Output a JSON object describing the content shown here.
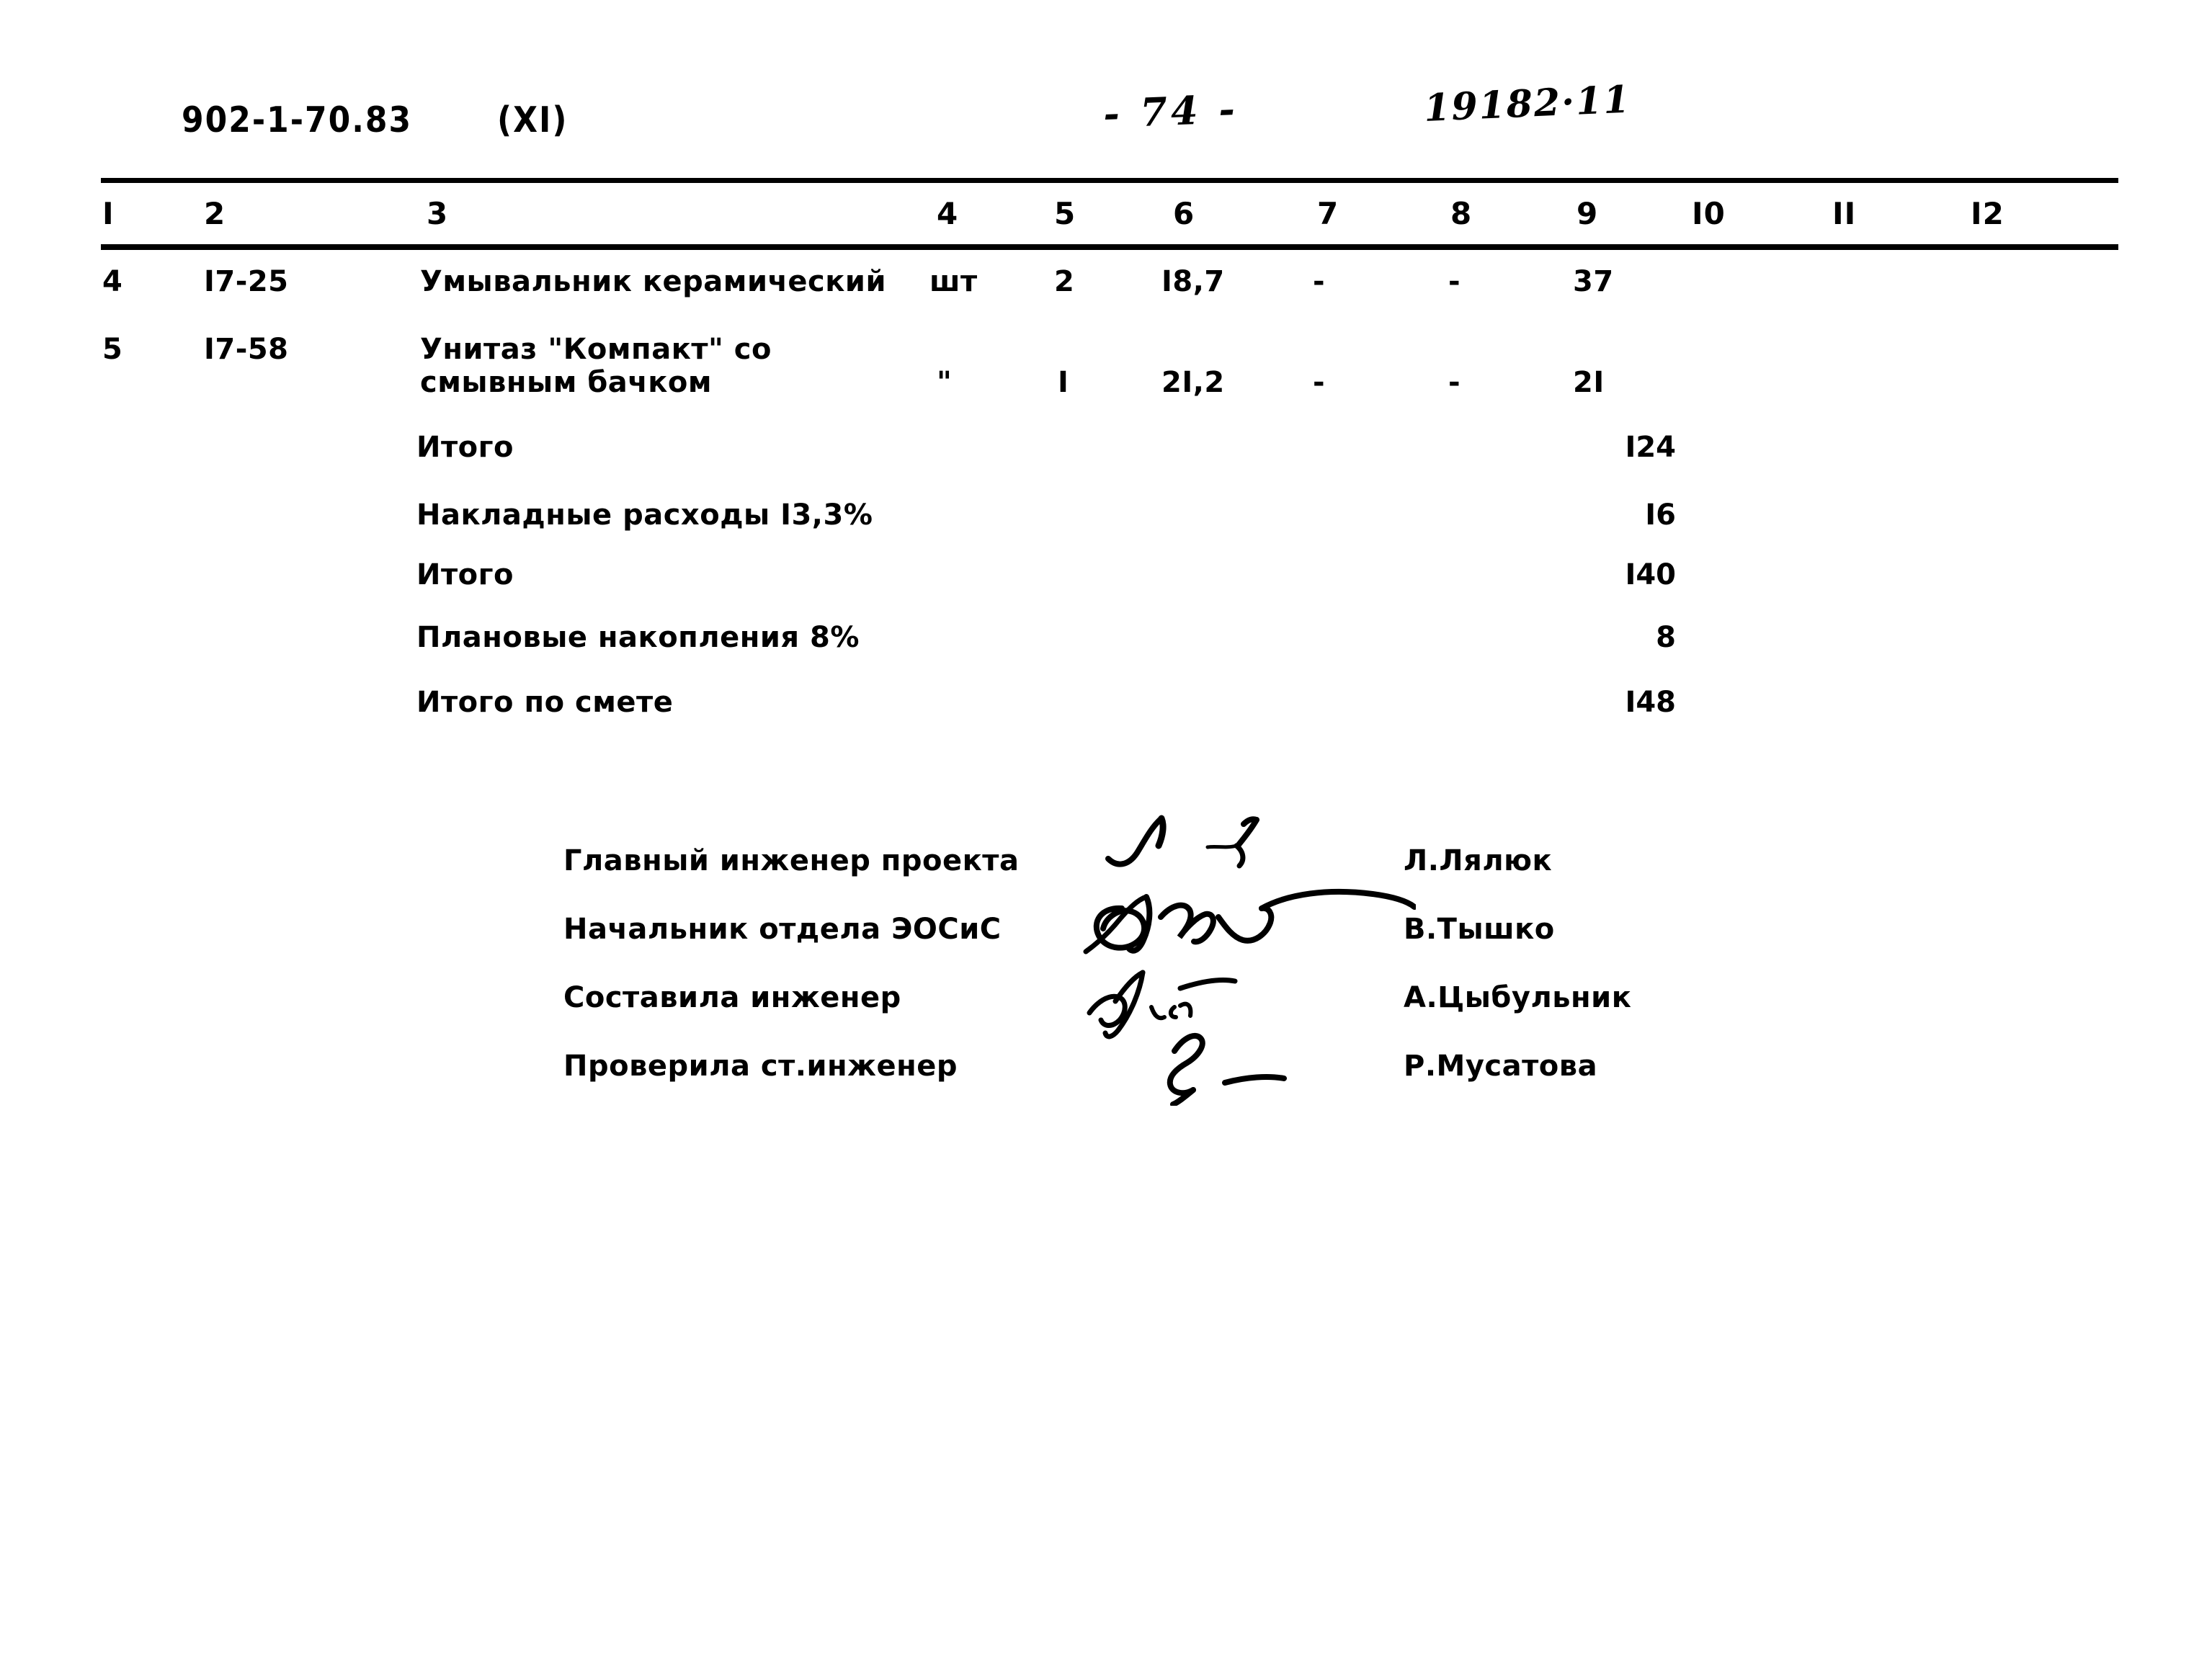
{
  "document": {
    "code": "902-1-70.83",
    "section": "(XI)",
    "page_number": "- 74 -",
    "reference": "19182·11"
  },
  "table": {
    "column_headers": [
      "I",
      "2",
      "3",
      "4",
      "5",
      "6",
      "7",
      "8",
      "9",
      "I0",
      "II",
      "I2"
    ],
    "rows": [
      {
        "num": "4",
        "code": "I7-25",
        "name_line1": "Умывальник керамический",
        "name_line2": "",
        "unit": "шт",
        "qty": "2",
        "col6": "I8,7",
        "col7": "-",
        "col8": "-",
        "col9": "37",
        "col10": "",
        "col11": "",
        "col12": ""
      },
      {
        "num": "5",
        "code": "I7-58",
        "name_line1": "Унитаз \"Компакт\" со",
        "name_line2": "смывным бачком",
        "unit": "\"",
        "qty": "I",
        "col6": "2I,2",
        "col7": "-",
        "col8": "-",
        "col9": "2I",
        "col10": "",
        "col11": "",
        "col12": ""
      }
    ],
    "summary": [
      {
        "label": "Итого",
        "value": "I24"
      },
      {
        "label": "Накладные расходы I3,3%",
        "value": "I6"
      },
      {
        "label": "Итого",
        "value": "I40"
      },
      {
        "label": "Плановые накопления 8%",
        "value": "8"
      },
      {
        "label": "Итого по смете",
        "value": "I48"
      }
    ]
  },
  "signatures": [
    {
      "role": "Главный инженер проекта",
      "name": "Л.Лялюк",
      "mark": "signature-mark-1"
    },
    {
      "role": "Начальник отдела ЭОСиС",
      "name": "В.Тышко",
      "mark": "signature-mark-2"
    },
    {
      "role": "Составила инженер",
      "name": "А.Цыбульник",
      "mark": "signature-mark-3"
    },
    {
      "role": "Проверила ст.инженер",
      "name": "Р.Мусатова",
      "mark": "signature-mark-4"
    }
  ],
  "colors": {
    "ink": "#000000",
    "paper": "#ffffff"
  }
}
